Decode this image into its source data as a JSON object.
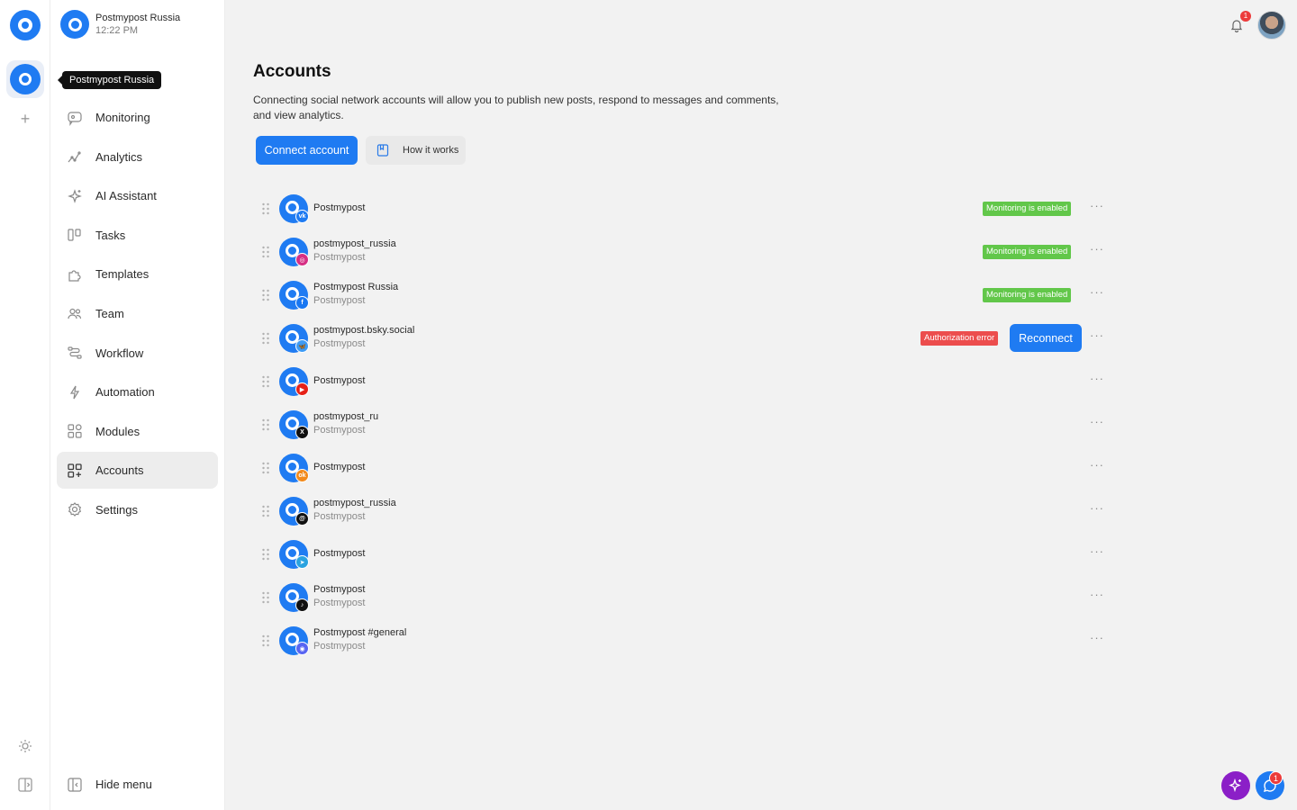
{
  "workspace": {
    "name": "Postmypost Russia",
    "time": "12:22 PM",
    "tooltip": "Postmypost Russia"
  },
  "sidebar": {
    "items": [
      {
        "label": "Monitoring",
        "icon": "chat-bubble-icon"
      },
      {
        "label": "Analytics",
        "icon": "line-chart-icon"
      },
      {
        "label": "AI Assistant",
        "icon": "sparkle-icon"
      },
      {
        "label": "Tasks",
        "icon": "kanban-icon"
      },
      {
        "label": "Templates",
        "icon": "puzzle-icon"
      },
      {
        "label": "Team",
        "icon": "users-icon"
      },
      {
        "label": "Workflow",
        "icon": "workflow-icon"
      },
      {
        "label": "Automation",
        "icon": "lightning-icon"
      },
      {
        "label": "Modules",
        "icon": "grid-icon"
      },
      {
        "label": "Accounts",
        "icon": "accounts-grid-icon",
        "active": true
      },
      {
        "label": "Settings",
        "icon": "gear-icon"
      }
    ],
    "hide_menu": "Hide menu"
  },
  "main": {
    "title": "Accounts",
    "description": "Connecting social network accounts will allow you to publish new posts, respond to messages and comments, and view analytics.",
    "connect_button": "Connect account",
    "how_button": "How it works"
  },
  "status": {
    "monitoring": "Monitoring is enabled",
    "auth_error": "Authorization error",
    "reconnect": "Reconnect"
  },
  "accounts": [
    {
      "name": "Postmypost",
      "sub": "",
      "network": "vk",
      "net_color": "#1f7bf2",
      "net_glyph": "vk",
      "status": "monitoring"
    },
    {
      "name": "postmypost_russia",
      "sub": "Postmypost",
      "network": "instagram",
      "net_color": "#d62f84",
      "net_glyph": "◎",
      "status": "monitoring"
    },
    {
      "name": "Postmypost Russia",
      "sub": "Postmypost",
      "network": "facebook",
      "net_color": "#1877f2",
      "net_glyph": "f",
      "status": "monitoring"
    },
    {
      "name": "postmypost.bsky.social",
      "sub": "Postmypost",
      "network": "bluesky",
      "net_color": "#3d9bf5",
      "net_glyph": "🦋",
      "status": "error"
    },
    {
      "name": "Postmypost",
      "sub": "",
      "network": "youtube",
      "net_color": "#e62117",
      "net_glyph": "▶",
      "status": ""
    },
    {
      "name": "postmypost_ru",
      "sub": "Postmypost",
      "network": "x",
      "net_color": "#111111",
      "net_glyph": "X",
      "status": ""
    },
    {
      "name": "Postmypost",
      "sub": "",
      "network": "odnoklassniki",
      "net_color": "#f28a1c",
      "net_glyph": "ok",
      "status": ""
    },
    {
      "name": "postmypost_russia",
      "sub": "Postmypost",
      "network": "threads",
      "net_color": "#111111",
      "net_glyph": "@",
      "status": ""
    },
    {
      "name": "Postmypost",
      "sub": "",
      "network": "telegram",
      "net_color": "#2aa3e0",
      "net_glyph": "➤",
      "status": ""
    },
    {
      "name": "Postmypost",
      "sub": "Postmypost",
      "network": "tiktok",
      "net_color": "#111111",
      "net_glyph": "♪",
      "status": ""
    },
    {
      "name": "Postmypost #general",
      "sub": "Postmypost",
      "network": "discord",
      "net_color": "#5865f2",
      "net_glyph": "◉",
      "status": ""
    }
  ],
  "topbar": {
    "notifications_count": "1",
    "chat_count": "1"
  }
}
